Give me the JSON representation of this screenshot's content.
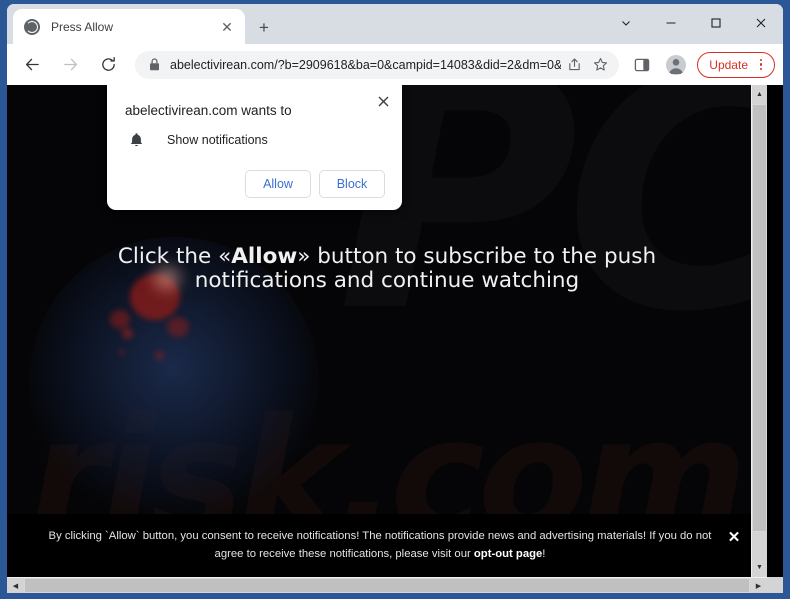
{
  "browser": {
    "tab": {
      "title": "Press Allow",
      "favicon": "globe-icon",
      "close_label": "✕"
    },
    "new_tab_label": "+",
    "window_controls": {
      "tab_search": "⌄",
      "minimize": "—",
      "maximize": "□",
      "close": "✕"
    },
    "toolbar": {
      "back": "←",
      "forward": "→",
      "reload": "↻",
      "lock_icon": "lock-icon",
      "url": "abelectivirean.com/?b=2909618&ba=0&campid=14083&did=2&dm=0&...",
      "share_icon": "share-icon",
      "bookmark_icon": "star-icon",
      "side_panel_icon": "side-panel-icon",
      "profile_icon": "profile-avatar-icon",
      "update_label": "Update",
      "update_color": "#d93025",
      "menu_icon": "kebab-menu-icon"
    }
  },
  "permission_dialog": {
    "title": "abelectivirean.com wants to",
    "permission_icon": "bell-icon",
    "permission_label": "Show notifications",
    "allow_label": "Allow",
    "block_label": "Block",
    "close_label": "✕",
    "button_text_color": "#3b6ed4"
  },
  "page": {
    "background_color": "#050507",
    "watermark_primary": "PC",
    "watermark_secondary": "risk.com",
    "headline_part1": "Click the «Allow»",
    "headline_bold": "Allow",
    "headline_prefix": "Click the «",
    "headline_suffix": "» button to subscribe to the push notifications and continue watching",
    "headline_full": "Click the «Allow» button to subscribe to the push notifications and continue watching",
    "consent": {
      "text_before_link": "By clicking `Allow` button, you consent to receive notifications! The notifications provide news and advertising materials! If you do not agree to receive these notifications, please visit our ",
      "link_label": "opt-out page",
      "text_after_link": "!",
      "close_label": "✕"
    }
  },
  "scrollbars": {
    "up_arrow": "▲",
    "down_arrow": "▼",
    "left_arrow": "◀",
    "right_arrow": "▶"
  }
}
